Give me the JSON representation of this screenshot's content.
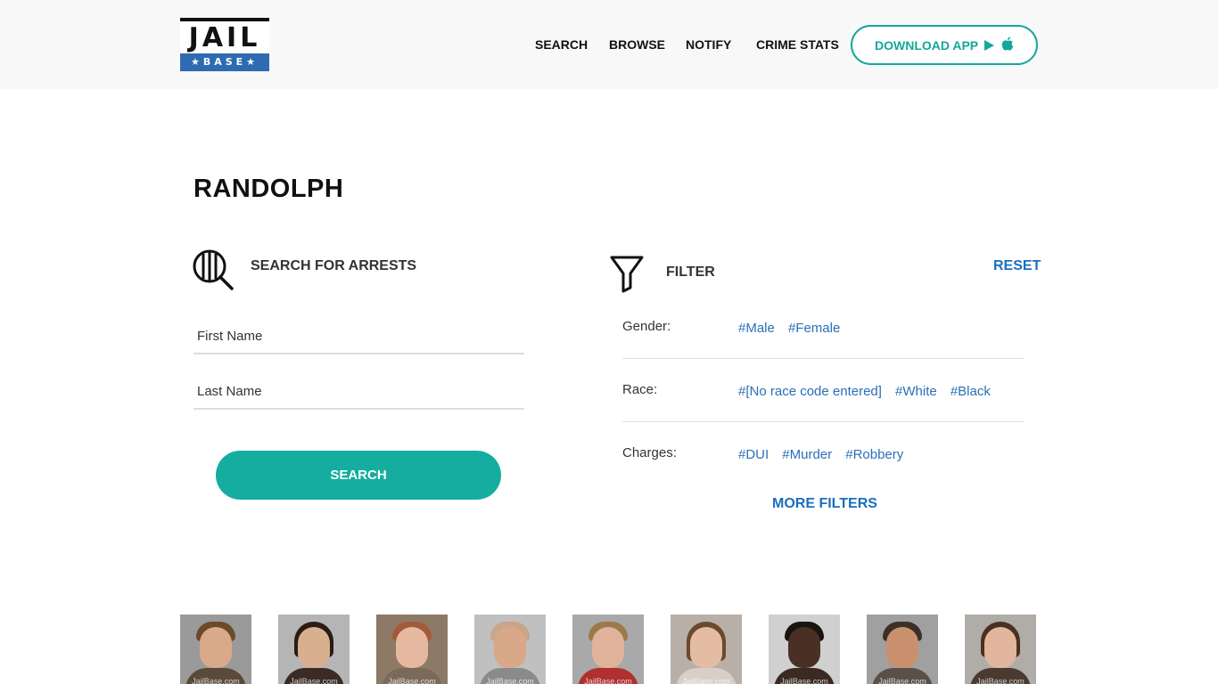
{
  "logo": {
    "word": "JAIL",
    "sub": "★BASE★"
  },
  "nav": {
    "search": "SEARCH",
    "browse": "BROWSE",
    "notify": "NOTIFY",
    "crime_stats": "CRIME STATS",
    "download_app": "DOWNLOAD APP",
    "icons": [
      "google-play-icon",
      "apple-icon"
    ]
  },
  "page": {
    "title": "RANDOLPH"
  },
  "search": {
    "heading": "SEARCH FOR ARRESTS",
    "first_name_placeholder": "First Name",
    "last_name_placeholder": "Last Name",
    "button": "SEARCH"
  },
  "filter": {
    "heading": "FILTER",
    "reset": "RESET",
    "rows": [
      {
        "label": "Gender:",
        "tags": [
          "#Male",
          "#Female"
        ]
      },
      {
        "label": "Race:",
        "tags": [
          "#[No race code entered]",
          "#White",
          "#Black"
        ]
      },
      {
        "label": "Charges:",
        "tags": [
          "#DUI",
          "#Murder",
          "#Robbery"
        ]
      }
    ],
    "more": "MORE FILTERS"
  },
  "mugshots": {
    "watermark": "JailBase.com",
    "count": 9
  },
  "colors": {
    "teal": "#14ada0",
    "link_blue": "#1a6fbf",
    "logo_blue": "#2f6bb0",
    "header_bg": "#f8f8f8"
  }
}
